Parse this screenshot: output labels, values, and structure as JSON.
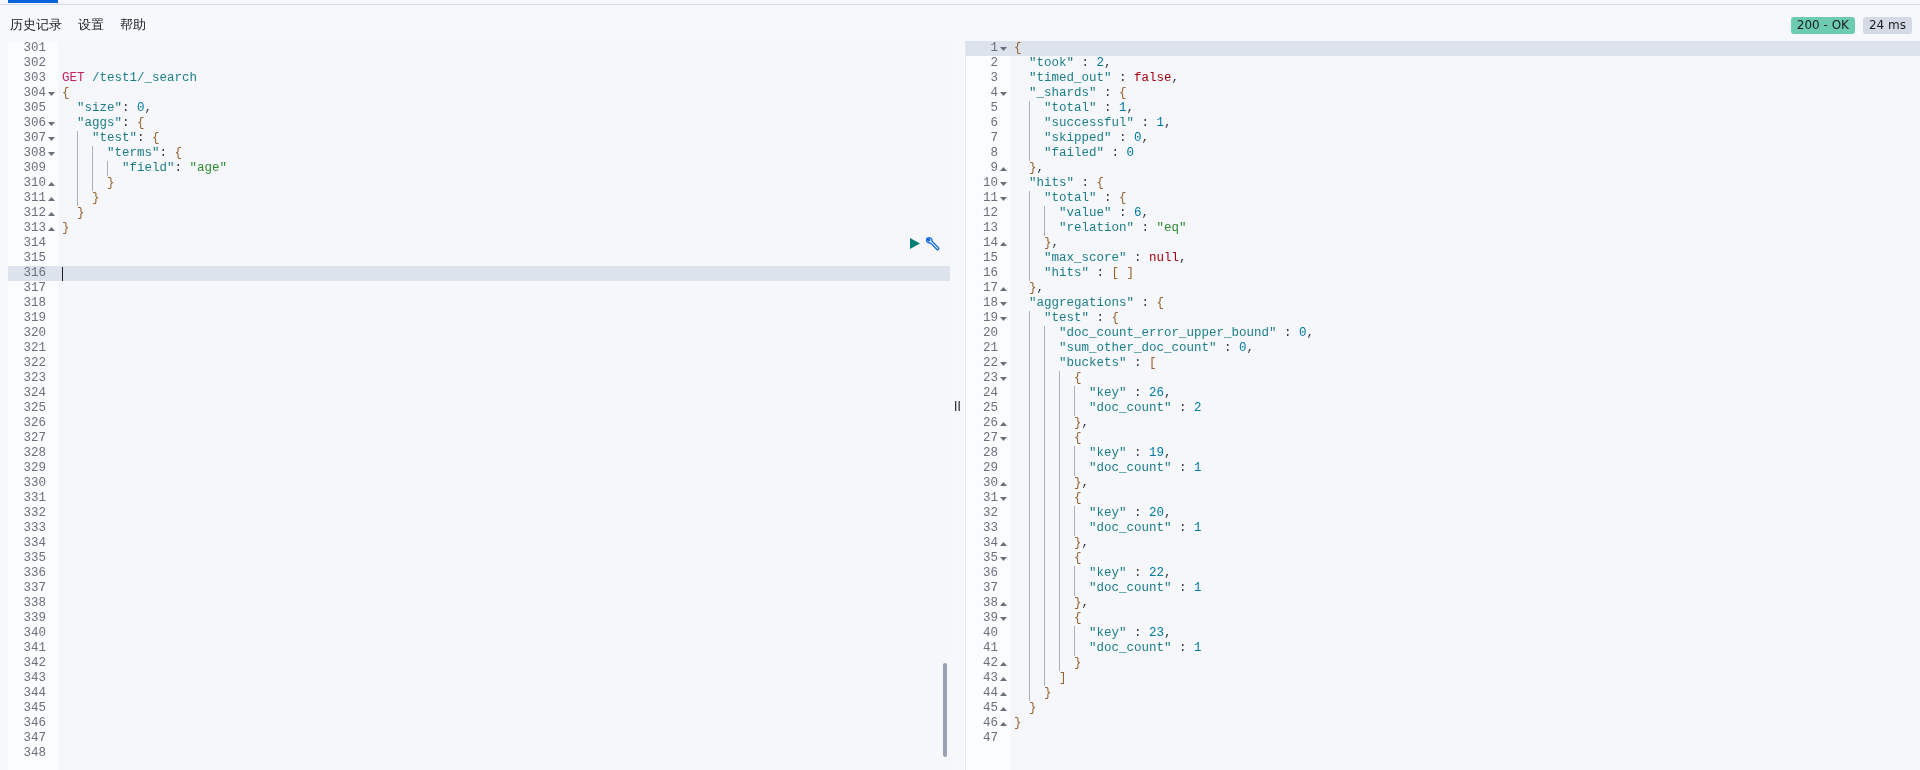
{
  "menu": {
    "items": [
      {
        "label": "历史记录"
      },
      {
        "label": "设置"
      },
      {
        "label": "帮助"
      }
    ]
  },
  "status": {
    "code": "200 - OK",
    "time": "24 ms"
  },
  "request_editor": {
    "lines": [
      {
        "number": "301",
        "fold_open": false,
        "fold_close": false,
        "active": false,
        "cursor": false
      },
      {
        "number": "302",
        "fold_open": false,
        "fold_close": false,
        "active": false,
        "cursor": false
      },
      {
        "number": "303",
        "fold_open": false,
        "fold_close": false,
        "active": false,
        "cursor": false,
        "tokens": [
          {
            "kind": "method",
            "text": "GET"
          },
          {
            "kind": "path",
            "text": " /test1/_search"
          }
        ]
      },
      {
        "number": "304",
        "fold_open": true,
        "fold_close": false,
        "active": false,
        "cursor": false,
        "tokens": [
          {
            "kind": "brace",
            "text": "{"
          }
        ]
      },
      {
        "number": "305",
        "fold_open": false,
        "fold_close": false,
        "active": false,
        "cursor": false,
        "tokens": [
          {
            "kind": "key",
            "text": "  \"size\""
          },
          {
            "kind": "punct",
            "text": ": "
          },
          {
            "kind": "number",
            "text": "0"
          },
          {
            "kind": "punct",
            "text": ","
          }
        ]
      },
      {
        "number": "306",
        "fold_open": true,
        "fold_close": false,
        "active": false,
        "cursor": false,
        "tokens": [
          {
            "kind": "key",
            "text": "  \"aggs\""
          },
          {
            "kind": "punct",
            "text": ": "
          },
          {
            "kind": "brace",
            "text": "{"
          }
        ]
      },
      {
        "number": "307",
        "fold_open": true,
        "fold_close": false,
        "active": false,
        "cursor": false,
        "tokens": [
          {
            "kind": "key",
            "text": "    \"test\""
          },
          {
            "kind": "punct",
            "text": ": "
          },
          {
            "kind": "brace",
            "text": "{"
          }
        ]
      },
      {
        "number": "308",
        "fold_open": true,
        "fold_close": false,
        "active": false,
        "cursor": false,
        "tokens": [
          {
            "kind": "key",
            "text": "      \"terms\""
          },
          {
            "kind": "punct",
            "text": ": "
          },
          {
            "kind": "brace",
            "text": "{"
          }
        ]
      },
      {
        "number": "309",
        "fold_open": false,
        "fold_close": false,
        "active": false,
        "cursor": false,
        "tokens": [
          {
            "kind": "key",
            "text": "        \"field\""
          },
          {
            "kind": "punct",
            "text": ": "
          },
          {
            "kind": "string",
            "text": "\"age\""
          }
        ]
      },
      {
        "number": "310",
        "fold_open": false,
        "fold_close": true,
        "active": false,
        "cursor": false,
        "tokens": [
          {
            "kind": "brace",
            "text": "      }"
          }
        ]
      },
      {
        "number": "311",
        "fold_open": false,
        "fold_close": true,
        "active": false,
        "cursor": false,
        "tokens": [
          {
            "kind": "brace",
            "text": "    }"
          }
        ]
      },
      {
        "number": "312",
        "fold_open": false,
        "fold_close": true,
        "active": false,
        "cursor": false,
        "tokens": [
          {
            "kind": "brace",
            "text": "  }"
          }
        ]
      },
      {
        "number": "313",
        "fold_open": false,
        "fold_close": true,
        "active": false,
        "cursor": false,
        "tokens": [
          {
            "kind": "brace",
            "text": "}"
          }
        ]
      },
      {
        "number": "314",
        "fold_open": false,
        "fold_close": false,
        "active": false,
        "cursor": false,
        "actions": [
          {
            "kind": "play"
          },
          {
            "kind": "wrench"
          }
        ]
      },
      {
        "number": "315",
        "fold_open": false,
        "fold_close": false,
        "active": false,
        "cursor": false
      },
      {
        "number": "316",
        "fold_open": false,
        "fold_close": false,
        "active": true,
        "cursor": true
      },
      {
        "number": "317",
        "fold_open": false,
        "fold_close": false,
        "active": false,
        "cursor": false
      },
      {
        "number": "318",
        "fold_open": false,
        "fold_close": false,
        "active": false,
        "cursor": false
      },
      {
        "number": "319",
        "fold_open": false,
        "fold_close": false,
        "active": false,
        "cursor": false
      },
      {
        "number": "320",
        "fold_open": false,
        "fold_close": false,
        "active": false,
        "cursor": false
      },
      {
        "number": "321",
        "fold_open": false,
        "fold_close": false,
        "active": false,
        "cursor": false
      },
      {
        "number": "322",
        "fold_open": false,
        "fold_close": false,
        "active": false,
        "cursor": false
      },
      {
        "number": "323",
        "fold_open": false,
        "fold_close": false,
        "active": false,
        "cursor": false
      },
      {
        "number": "324",
        "fold_open": false,
        "fold_close": false,
        "active": false,
        "cursor": false
      },
      {
        "number": "325",
        "fold_open": false,
        "fold_close": false,
        "active": false,
        "cursor": false
      },
      {
        "number": "326",
        "fold_open": false,
        "fold_close": false,
        "active": false,
        "cursor": false
      },
      {
        "number": "327",
        "fold_open": false,
        "fold_close": false,
        "active": false,
        "cursor": false
      },
      {
        "number": "328",
        "fold_open": false,
        "fold_close": false,
        "active": false,
        "cursor": false
      },
      {
        "number": "329",
        "fold_open": false,
        "fold_close": false,
        "active": false,
        "cursor": false
      },
      {
        "number": "330",
        "fold_open": false,
        "fold_close": false,
        "active": false,
        "cursor": false
      },
      {
        "number": "331",
        "fold_open": false,
        "fold_close": false,
        "active": false,
        "cursor": false
      },
      {
        "number": "332",
        "fold_open": false,
        "fold_close": false,
        "active": false,
        "cursor": false
      },
      {
        "number": "333",
        "fold_open": false,
        "fold_close": false,
        "active": false,
        "cursor": false
      },
      {
        "number": "334",
        "fold_open": false,
        "fold_close": false,
        "active": false,
        "cursor": false
      },
      {
        "number": "335",
        "fold_open": false,
        "fold_close": false,
        "active": false,
        "cursor": false
      },
      {
        "number": "336",
        "fold_open": false,
        "fold_close": false,
        "active": false,
        "cursor": false
      },
      {
        "number": "337",
        "fold_open": false,
        "fold_close": false,
        "active": false,
        "cursor": false
      },
      {
        "number": "338",
        "fold_open": false,
        "fold_close": false,
        "active": false,
        "cursor": false
      },
      {
        "number": "339",
        "fold_open": false,
        "fold_close": false,
        "active": false,
        "cursor": false
      },
      {
        "number": "340",
        "fold_open": false,
        "fold_close": false,
        "active": false,
        "cursor": false
      },
      {
        "number": "341",
        "fold_open": false,
        "fold_close": false,
        "active": false,
        "cursor": false
      },
      {
        "number": "342",
        "fold_open": false,
        "fold_close": false,
        "active": false,
        "cursor": false
      },
      {
        "number": "343",
        "fold_open": false,
        "fold_close": false,
        "active": false,
        "cursor": false
      },
      {
        "number": "344",
        "fold_open": false,
        "fold_close": false,
        "active": false,
        "cursor": false
      },
      {
        "number": "345",
        "fold_open": false,
        "fold_close": false,
        "active": false,
        "cursor": false
      },
      {
        "number": "346",
        "fold_open": false,
        "fold_close": false,
        "active": false,
        "cursor": false
      },
      {
        "number": "347",
        "fold_open": false,
        "fold_close": false,
        "active": false,
        "cursor": false
      },
      {
        "number": "348",
        "fold_open": false,
        "fold_close": false,
        "active": false,
        "cursor": false
      }
    ]
  },
  "response_editor": {
    "lines": [
      {
        "number": "1",
        "fold_open": true,
        "fold_close": false,
        "active": true,
        "tokens": [
          {
            "kind": "brace",
            "text": "{"
          }
        ]
      },
      {
        "number": "2",
        "fold_open": false,
        "fold_close": false,
        "active": false,
        "tokens": [
          {
            "kind": "key",
            "text": "  \"took\""
          },
          {
            "kind": "punct",
            "text": " : "
          },
          {
            "kind": "number",
            "text": "2"
          },
          {
            "kind": "punct",
            "text": ","
          }
        ]
      },
      {
        "number": "3",
        "fold_open": false,
        "fold_close": false,
        "active": false,
        "tokens": [
          {
            "kind": "key",
            "text": "  \"timed_out\""
          },
          {
            "kind": "punct",
            "text": " : "
          },
          {
            "kind": "literal",
            "text": "false"
          },
          {
            "kind": "punct",
            "text": ","
          }
        ]
      },
      {
        "number": "4",
        "fold_open": true,
        "fold_close": false,
        "active": false,
        "tokens": [
          {
            "kind": "key",
            "text": "  \"_shards\""
          },
          {
            "kind": "punct",
            "text": " : "
          },
          {
            "kind": "brace",
            "text": "{"
          }
        ]
      },
      {
        "number": "5",
        "fold_open": false,
        "fold_close": false,
        "active": false,
        "tokens": [
          {
            "kind": "key",
            "text": "    \"total\""
          },
          {
            "kind": "punct",
            "text": " : "
          },
          {
            "kind": "number",
            "text": "1"
          },
          {
            "kind": "punct",
            "text": ","
          }
        ]
      },
      {
        "number": "6",
        "fold_open": false,
        "fold_close": false,
        "active": false,
        "tokens": [
          {
            "kind": "key",
            "text": "    \"successful\""
          },
          {
            "kind": "punct",
            "text": " : "
          },
          {
            "kind": "number",
            "text": "1"
          },
          {
            "kind": "punct",
            "text": ","
          }
        ]
      },
      {
        "number": "7",
        "fold_open": false,
        "fold_close": false,
        "active": false,
        "tokens": [
          {
            "kind": "key",
            "text": "    \"skipped\""
          },
          {
            "kind": "punct",
            "text": " : "
          },
          {
            "kind": "number",
            "text": "0"
          },
          {
            "kind": "punct",
            "text": ","
          }
        ]
      },
      {
        "number": "8",
        "fold_open": false,
        "fold_close": false,
        "active": false,
        "tokens": [
          {
            "kind": "key",
            "text": "    \"failed\""
          },
          {
            "kind": "punct",
            "text": " : "
          },
          {
            "kind": "number",
            "text": "0"
          }
        ]
      },
      {
        "number": "9",
        "fold_open": false,
        "fold_close": true,
        "active": false,
        "tokens": [
          {
            "kind": "brace",
            "text": "  }"
          },
          {
            "kind": "punct",
            "text": ","
          }
        ]
      },
      {
        "number": "10",
        "fold_open": true,
        "fold_close": false,
        "active": false,
        "tokens": [
          {
            "kind": "key",
            "text": "  \"hits\""
          },
          {
            "kind": "punct",
            "text": " : "
          },
          {
            "kind": "brace",
            "text": "{"
          }
        ]
      },
      {
        "number": "11",
        "fold_open": true,
        "fold_close": false,
        "active": false,
        "tokens": [
          {
            "kind": "key",
            "text": "    \"total\""
          },
          {
            "kind": "punct",
            "text": " : "
          },
          {
            "kind": "brace",
            "text": "{"
          }
        ]
      },
      {
        "number": "12",
        "fold_open": false,
        "fold_close": false,
        "active": false,
        "tokens": [
          {
            "kind": "key",
            "text": "      \"value\""
          },
          {
            "kind": "punct",
            "text": " : "
          },
          {
            "kind": "number",
            "text": "6"
          },
          {
            "kind": "punct",
            "text": ","
          }
        ]
      },
      {
        "number": "13",
        "fold_open": false,
        "fold_close": false,
        "active": false,
        "tokens": [
          {
            "kind": "key",
            "text": "      \"relation\""
          },
          {
            "kind": "punct",
            "text": " : "
          },
          {
            "kind": "string",
            "text": "\"eq\""
          }
        ]
      },
      {
        "number": "14",
        "fold_open": false,
        "fold_close": true,
        "active": false,
        "tokens": [
          {
            "kind": "brace",
            "text": "    }"
          },
          {
            "kind": "punct",
            "text": ","
          }
        ]
      },
      {
        "number": "15",
        "fold_open": false,
        "fold_close": false,
        "active": false,
        "tokens": [
          {
            "kind": "key",
            "text": "    \"max_score\""
          },
          {
            "kind": "punct",
            "text": " : "
          },
          {
            "kind": "literal",
            "text": "null"
          },
          {
            "kind": "punct",
            "text": ","
          }
        ]
      },
      {
        "number": "16",
        "fold_open": false,
        "fold_close": false,
        "active": false,
        "tokens": [
          {
            "kind": "key",
            "text": "    \"hits\""
          },
          {
            "kind": "punct",
            "text": " : "
          },
          {
            "kind": "brace",
            "text": "[ ]"
          }
        ]
      },
      {
        "number": "17",
        "fold_open": false,
        "fold_close": true,
        "active": false,
        "tokens": [
          {
            "kind": "brace",
            "text": "  }"
          },
          {
            "kind": "punct",
            "text": ","
          }
        ]
      },
      {
        "number": "18",
        "fold_open": true,
        "fold_close": false,
        "active": false,
        "tokens": [
          {
            "kind": "key",
            "text": "  \"aggregations\""
          },
          {
            "kind": "punct",
            "text": " : "
          },
          {
            "kind": "brace",
            "text": "{"
          }
        ]
      },
      {
        "number": "19",
        "fold_open": true,
        "fold_close": false,
        "active": false,
        "tokens": [
          {
            "kind": "key",
            "text": "    \"test\""
          },
          {
            "kind": "punct",
            "text": " : "
          },
          {
            "kind": "brace",
            "text": "{"
          }
        ]
      },
      {
        "number": "20",
        "fold_open": false,
        "fold_close": false,
        "active": false,
        "tokens": [
          {
            "kind": "key",
            "text": "      \"doc_count_error_upper_bound\""
          },
          {
            "kind": "punct",
            "text": " : "
          },
          {
            "kind": "number",
            "text": "0"
          },
          {
            "kind": "punct",
            "text": ","
          }
        ]
      },
      {
        "number": "21",
        "fold_open": false,
        "fold_close": false,
        "active": false,
        "tokens": [
          {
            "kind": "key",
            "text": "      \"sum_other_doc_count\""
          },
          {
            "kind": "punct",
            "text": " : "
          },
          {
            "kind": "number",
            "text": "0"
          },
          {
            "kind": "punct",
            "text": ","
          }
        ]
      },
      {
        "number": "22",
        "fold_open": true,
        "fold_close": false,
        "active": false,
        "tokens": [
          {
            "kind": "key",
            "text": "      \"buckets\""
          },
          {
            "kind": "punct",
            "text": " : "
          },
          {
            "kind": "brace",
            "text": "["
          }
        ]
      },
      {
        "number": "23",
        "fold_open": true,
        "fold_close": false,
        "active": false,
        "tokens": [
          {
            "kind": "brace",
            "text": "        {"
          }
        ]
      },
      {
        "number": "24",
        "fold_open": false,
        "fold_close": false,
        "active": false,
        "tokens": [
          {
            "kind": "key",
            "text": "          \"key\""
          },
          {
            "kind": "punct",
            "text": " : "
          },
          {
            "kind": "number",
            "text": "26"
          },
          {
            "kind": "punct",
            "text": ","
          }
        ]
      },
      {
        "number": "25",
        "fold_open": false,
        "fold_close": false,
        "active": false,
        "tokens": [
          {
            "kind": "key",
            "text": "          \"doc_count\""
          },
          {
            "kind": "punct",
            "text": " : "
          },
          {
            "kind": "number",
            "text": "2"
          }
        ]
      },
      {
        "number": "26",
        "fold_open": false,
        "fold_close": true,
        "active": false,
        "tokens": [
          {
            "kind": "brace",
            "text": "        }"
          },
          {
            "kind": "punct",
            "text": ","
          }
        ]
      },
      {
        "number": "27",
        "fold_open": true,
        "fold_close": false,
        "active": false,
        "tokens": [
          {
            "kind": "brace",
            "text": "        {"
          }
        ]
      },
      {
        "number": "28",
        "fold_open": false,
        "fold_close": false,
        "active": false,
        "tokens": [
          {
            "kind": "key",
            "text": "          \"key\""
          },
          {
            "kind": "punct",
            "text": " : "
          },
          {
            "kind": "number",
            "text": "19"
          },
          {
            "kind": "punct",
            "text": ","
          }
        ]
      },
      {
        "number": "29",
        "fold_open": false,
        "fold_close": false,
        "active": false,
        "tokens": [
          {
            "kind": "key",
            "text": "          \"doc_count\""
          },
          {
            "kind": "punct",
            "text": " : "
          },
          {
            "kind": "number",
            "text": "1"
          }
        ]
      },
      {
        "number": "30",
        "fold_open": false,
        "fold_close": true,
        "active": false,
        "tokens": [
          {
            "kind": "brace",
            "text": "        }"
          },
          {
            "kind": "punct",
            "text": ","
          }
        ]
      },
      {
        "number": "31",
        "fold_open": true,
        "fold_close": false,
        "active": false,
        "tokens": [
          {
            "kind": "brace",
            "text": "        {"
          }
        ]
      },
      {
        "number": "32",
        "fold_open": false,
        "fold_close": false,
        "active": false,
        "tokens": [
          {
            "kind": "key",
            "text": "          \"key\""
          },
          {
            "kind": "punct",
            "text": " : "
          },
          {
            "kind": "number",
            "text": "20"
          },
          {
            "kind": "punct",
            "text": ","
          }
        ]
      },
      {
        "number": "33",
        "fold_open": false,
        "fold_close": false,
        "active": false,
        "tokens": [
          {
            "kind": "key",
            "text": "          \"doc_count\""
          },
          {
            "kind": "punct",
            "text": " : "
          },
          {
            "kind": "number",
            "text": "1"
          }
        ]
      },
      {
        "number": "34",
        "fold_open": false,
        "fold_close": true,
        "active": false,
        "tokens": [
          {
            "kind": "brace",
            "text": "        }"
          },
          {
            "kind": "punct",
            "text": ","
          }
        ]
      },
      {
        "number": "35",
        "fold_open": true,
        "fold_close": false,
        "active": false,
        "tokens": [
          {
            "kind": "brace",
            "text": "        {"
          }
        ]
      },
      {
        "number": "36",
        "fold_open": false,
        "fold_close": false,
        "active": false,
        "tokens": [
          {
            "kind": "key",
            "text": "          \"key\""
          },
          {
            "kind": "punct",
            "text": " : "
          },
          {
            "kind": "number",
            "text": "22"
          },
          {
            "kind": "punct",
            "text": ","
          }
        ]
      },
      {
        "number": "37",
        "fold_open": false,
        "fold_close": false,
        "active": false,
        "tokens": [
          {
            "kind": "key",
            "text": "          \"doc_count\""
          },
          {
            "kind": "punct",
            "text": " : "
          },
          {
            "kind": "number",
            "text": "1"
          }
        ]
      },
      {
        "number": "38",
        "fold_open": false,
        "fold_close": true,
        "active": false,
        "tokens": [
          {
            "kind": "brace",
            "text": "        }"
          },
          {
            "kind": "punct",
            "text": ","
          }
        ]
      },
      {
        "number": "39",
        "fold_open": true,
        "fold_close": false,
        "active": false,
        "tokens": [
          {
            "kind": "brace",
            "text": "        {"
          }
        ]
      },
      {
        "number": "40",
        "fold_open": false,
        "fold_close": false,
        "active": false,
        "tokens": [
          {
            "kind": "key",
            "text": "          \"key\""
          },
          {
            "kind": "punct",
            "text": " : "
          },
          {
            "kind": "number",
            "text": "23"
          },
          {
            "kind": "punct",
            "text": ","
          }
        ]
      },
      {
        "number": "41",
        "fold_open": false,
        "fold_close": false,
        "active": false,
        "tokens": [
          {
            "kind": "key",
            "text": "          \"doc_count\""
          },
          {
            "kind": "punct",
            "text": " : "
          },
          {
            "kind": "number",
            "text": "1"
          }
        ]
      },
      {
        "number": "42",
        "fold_open": false,
        "fold_close": true,
        "active": false,
        "tokens": [
          {
            "kind": "brace",
            "text": "        }"
          }
        ]
      },
      {
        "number": "43",
        "fold_open": false,
        "fold_close": true,
        "active": false,
        "tokens": [
          {
            "kind": "brace",
            "text": "      ]"
          }
        ]
      },
      {
        "number": "44",
        "fold_open": false,
        "fold_close": true,
        "active": false,
        "tokens": [
          {
            "kind": "brace",
            "text": "    }"
          }
        ]
      },
      {
        "number": "45",
        "fold_open": false,
        "fold_close": true,
        "active": false,
        "tokens": [
          {
            "kind": "brace",
            "text": "  }"
          }
        ]
      },
      {
        "number": "46",
        "fold_open": false,
        "fold_close": true,
        "active": false,
        "tokens": [
          {
            "kind": "brace",
            "text": "}"
          }
        ]
      },
      {
        "number": "47",
        "fold_open": false,
        "fold_close": false,
        "active": false
      }
    ]
  }
}
